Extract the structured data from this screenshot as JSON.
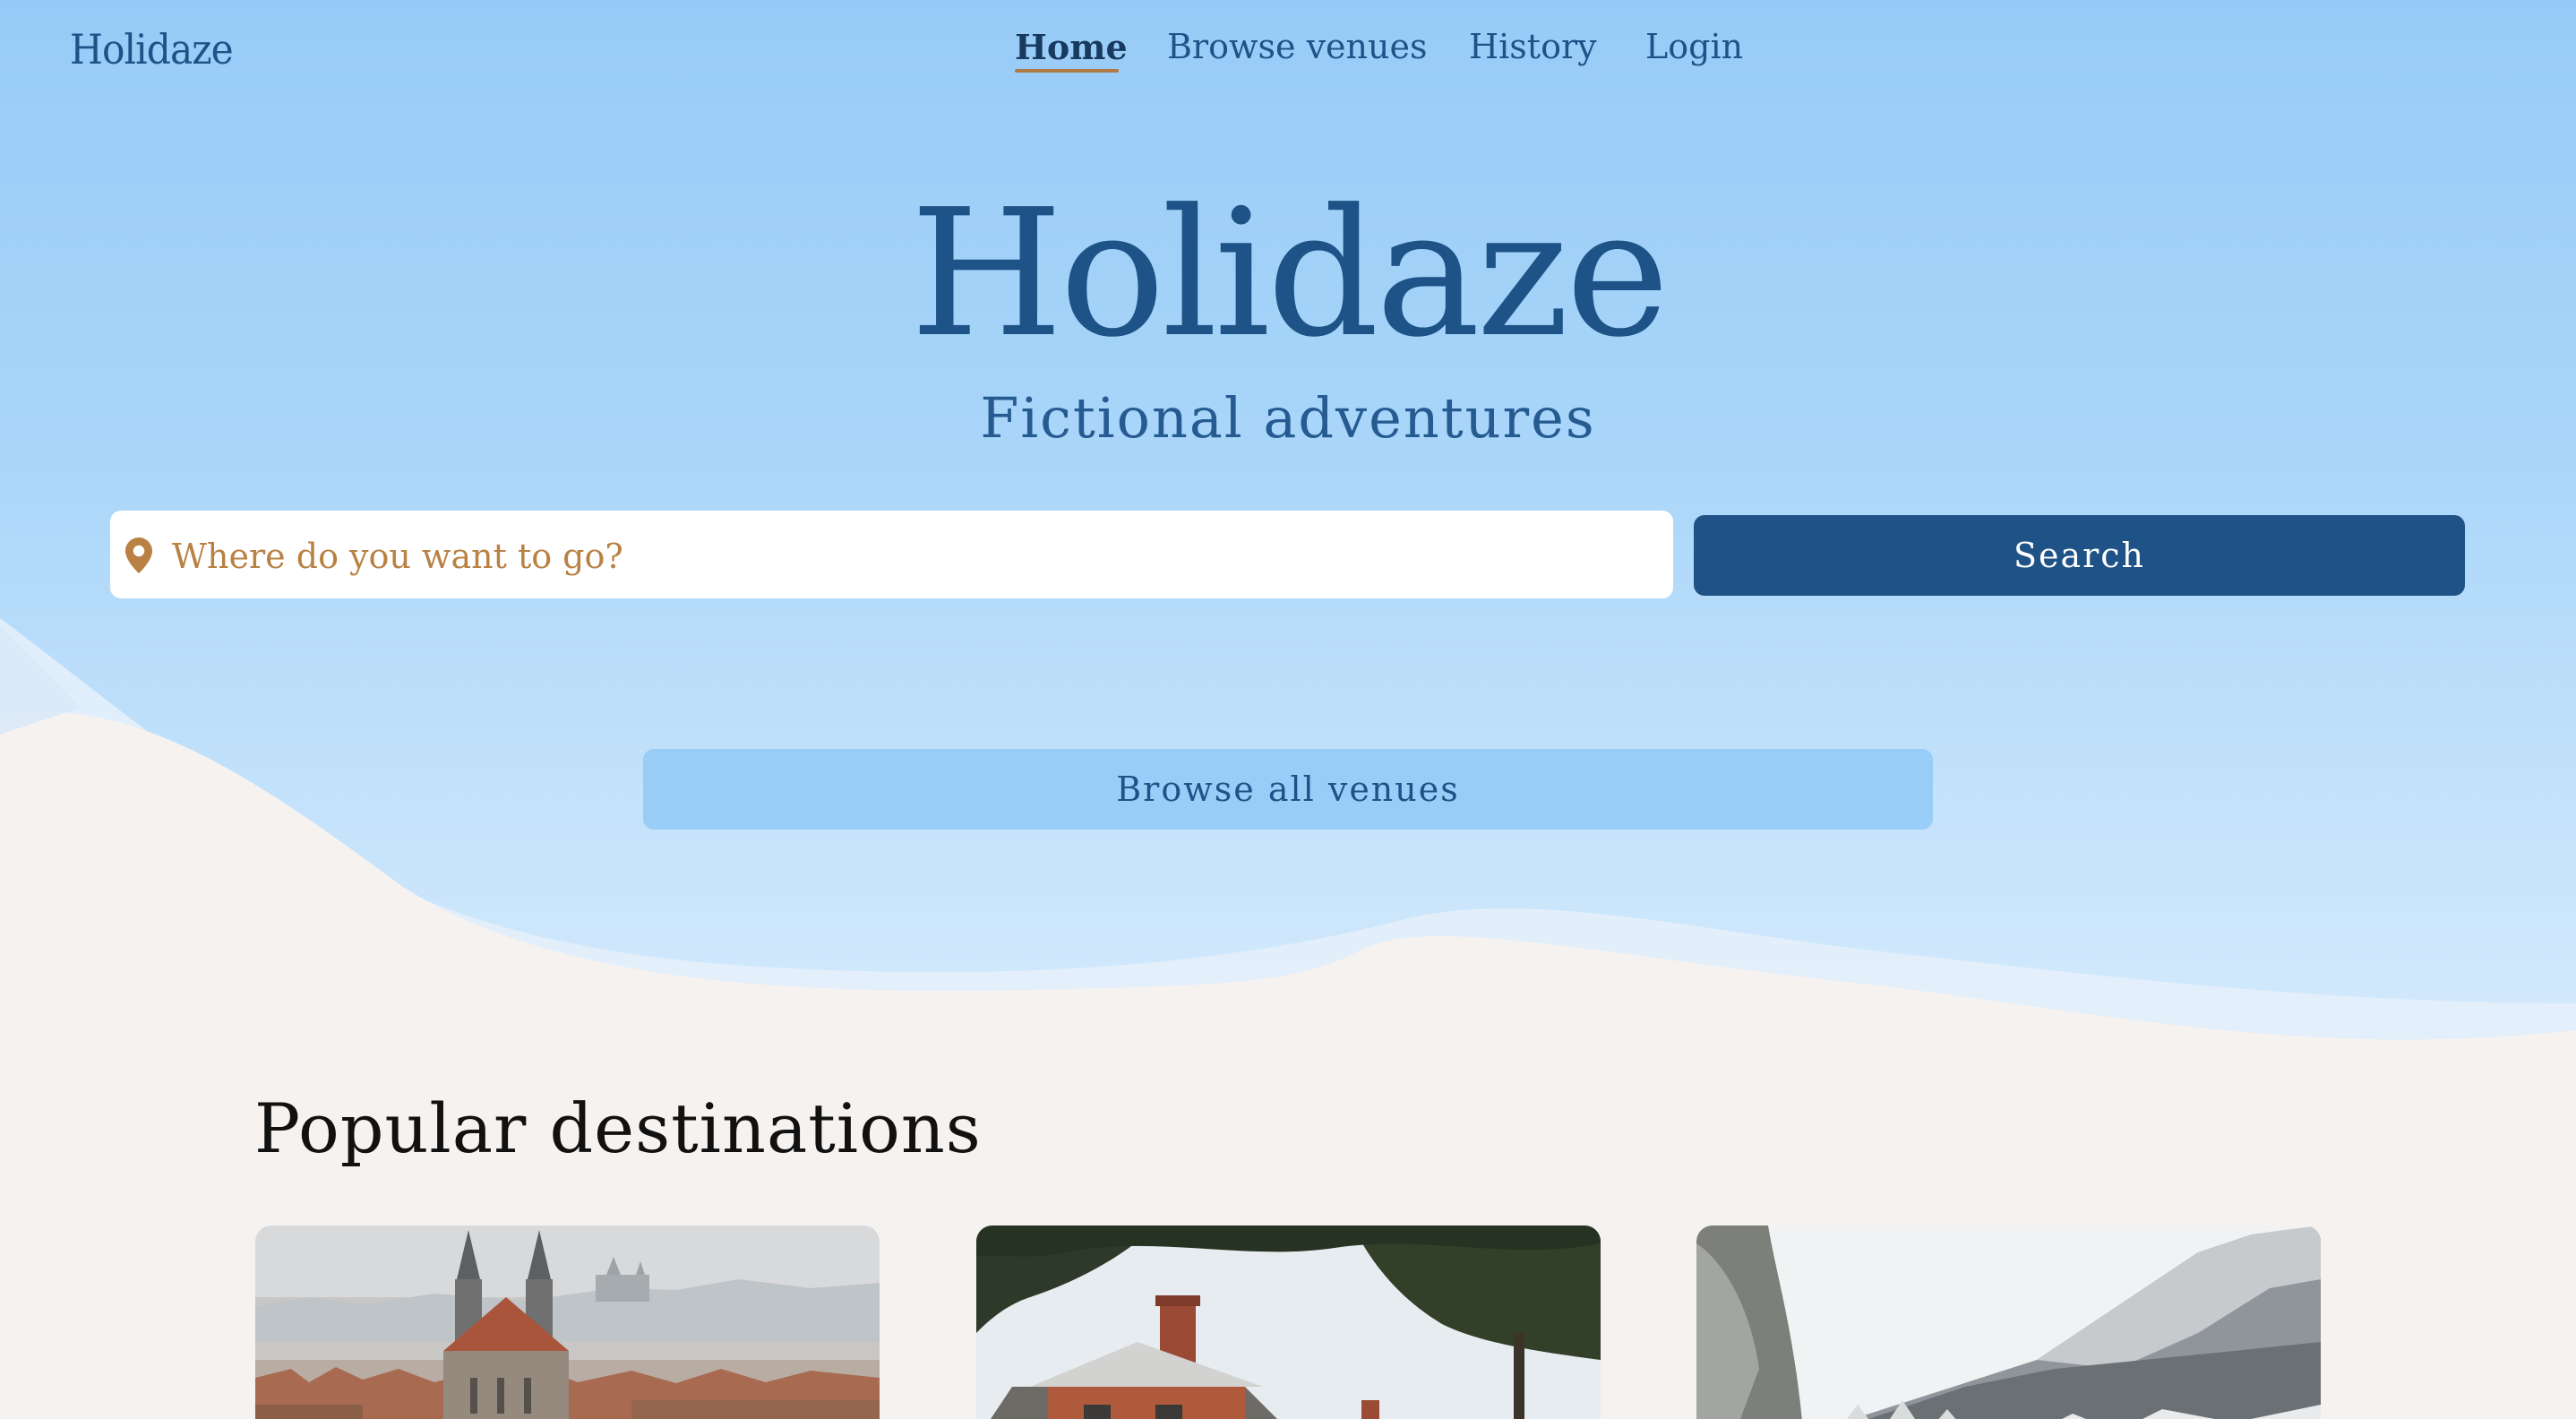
{
  "nav": {
    "logo": "Holidaze",
    "items": [
      {
        "label": "Home",
        "active": true
      },
      {
        "label": "Browse venues",
        "active": false
      },
      {
        "label": "History",
        "active": false
      },
      {
        "label": "Login",
        "active": false
      }
    ]
  },
  "hero": {
    "title": "Holidaze",
    "subtitle": "Fictional adventures"
  },
  "search": {
    "placeholder": "Where do you want to go?",
    "icon": "location-pin-icon",
    "button_label": "Search"
  },
  "browse": {
    "button_label": "Browse all venues"
  },
  "popular": {
    "title": "Popular destinations",
    "cards": [
      {
        "image": "prague-city-photo"
      },
      {
        "image": "country-house-photo"
      },
      {
        "image": "snowy-mountain-photo"
      }
    ]
  },
  "colors": {
    "primary": "#1f5286",
    "accent": "#b98143",
    "sky": "#97cbf7",
    "background": "#f6f2ef"
  }
}
